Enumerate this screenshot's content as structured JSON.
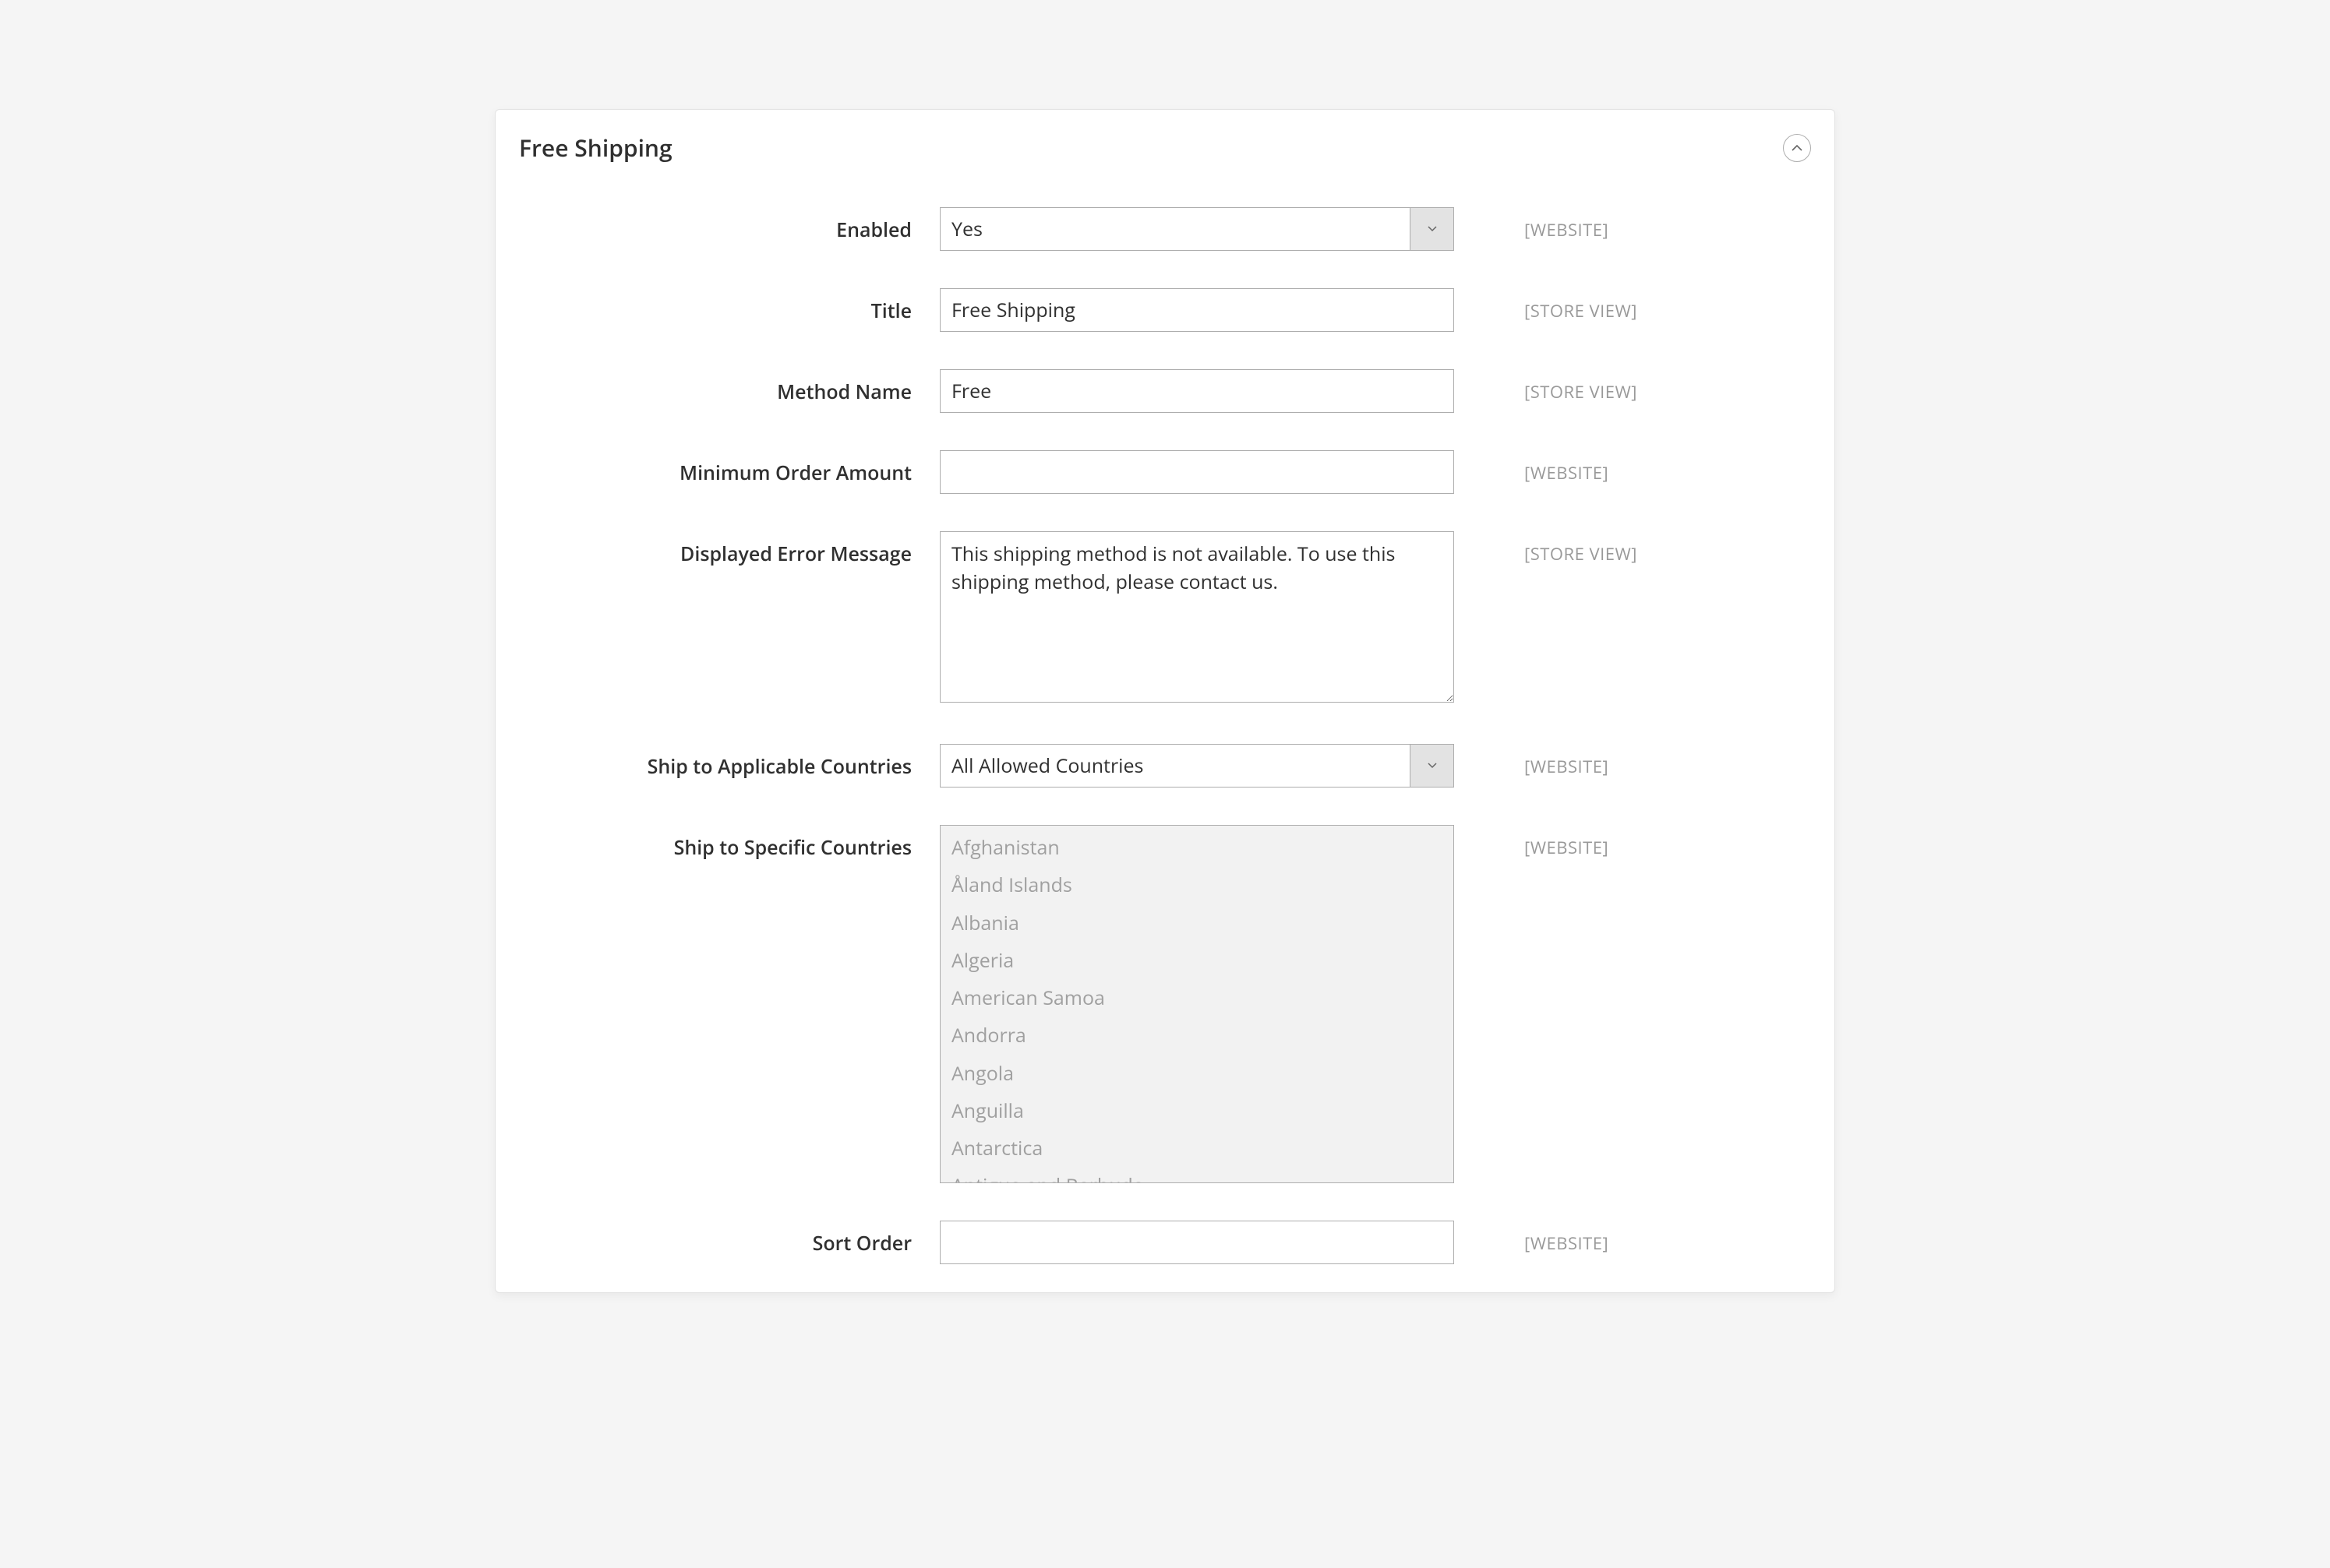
{
  "panel": {
    "title": "Free Shipping"
  },
  "scopes": {
    "website": "[WEBSITE]",
    "store_view": "[STORE VIEW]"
  },
  "fields": {
    "enabled": {
      "label": "Enabled",
      "value": "Yes",
      "scope": "website"
    },
    "title": {
      "label": "Title",
      "value": "Free Shipping",
      "scope": "store_view"
    },
    "method": {
      "label": "Method Name",
      "value": "Free",
      "scope": "store_view"
    },
    "min_order": {
      "label": "Minimum Order Amount",
      "value": "",
      "scope": "website"
    },
    "error_msg": {
      "label": "Displayed Error Message",
      "value": "This shipping method is not available. To use this shipping method, please contact us.",
      "scope": "store_view"
    },
    "ship_applicable": {
      "label": "Ship to Applicable Countries",
      "value": "All Allowed Countries",
      "scope": "website"
    },
    "ship_specific": {
      "label": "Ship to Specific Countries",
      "scope": "website",
      "options": [
        "Afghanistan",
        "Åland Islands",
        "Albania",
        "Algeria",
        "American Samoa",
        "Andorra",
        "Angola",
        "Anguilla",
        "Antarctica",
        "Antigua and Barbuda"
      ]
    },
    "sort_order": {
      "label": "Sort Order",
      "value": "",
      "scope": "website"
    }
  }
}
